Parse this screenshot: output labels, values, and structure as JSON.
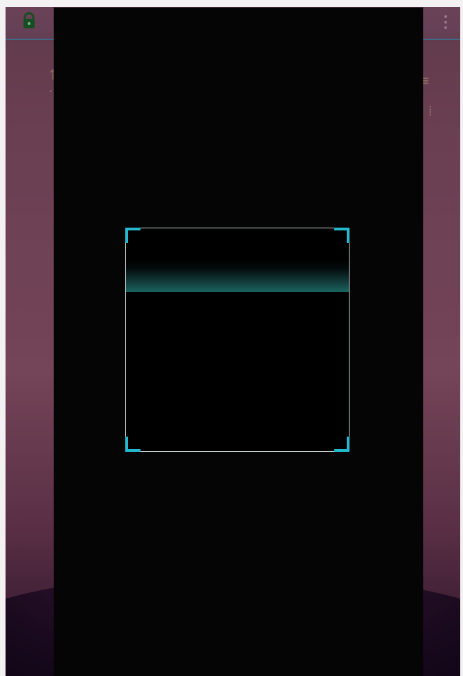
{
  "screen": {
    "title": "",
    "status": ""
  },
  "icons": {
    "lock": "lock-icon",
    "overflow": "more-vertical-icon",
    "corner_marker": "scanner-corner-icon"
  },
  "colors": {
    "background": "#6a3f52",
    "panel": "#050505",
    "frame": "#c9d6d4",
    "accent": "#26b8cf",
    "scan_line": "#1a6e68",
    "header_line": "#3f6c8b"
  },
  "scanner": {
    "label": ""
  }
}
